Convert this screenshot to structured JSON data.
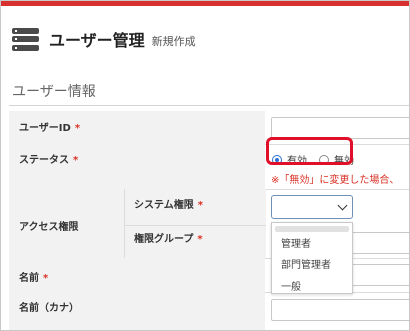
{
  "colors": {
    "top_bar": "#d7302f",
    "header_icon": "#4a4a4a",
    "label_bg": "#f2f2f2",
    "required": "#d93025",
    "radio_selected": "#2a6fd6",
    "highlight": "#e0102a"
  },
  "header": {
    "icon": "server-stack-icon",
    "title": "ユーザー管理",
    "subtitle": "新規作成"
  },
  "section": {
    "title": "ユーザー情報"
  },
  "form": {
    "required_mark": "*",
    "user_id": {
      "label": "ユーザーID",
      "value": ""
    },
    "status": {
      "label": "ステータス",
      "options": [
        {
          "label": "有効",
          "selected": true
        },
        {
          "label": "無効",
          "selected": false
        }
      ],
      "warning": "※「無効」に変更した場合、"
    },
    "access": {
      "label": "アクセス権限",
      "system_role": {
        "label": "システム権限",
        "selected": "",
        "options": [
          "",
          "管理者",
          "部門管理者",
          "一般"
        ],
        "highlighted_option": "部門管理者"
      },
      "role_group": {
        "label": "権限グループ"
      }
    },
    "name": {
      "label": "名前",
      "value": ""
    },
    "name_kana": {
      "label": "名前（カナ）",
      "value": ""
    }
  }
}
